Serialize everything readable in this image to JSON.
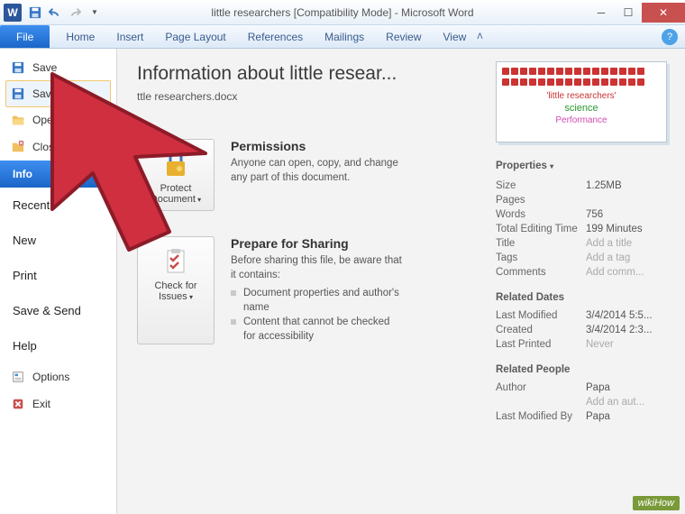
{
  "window": {
    "title": "little researchers [Compatibility Mode] - Microsoft Word"
  },
  "ribbon": {
    "file": "File",
    "tabs": [
      "Home",
      "Insert",
      "Page Layout",
      "References",
      "Mailings",
      "Review",
      "View"
    ]
  },
  "sidebar": {
    "save": "Save",
    "save_as": "Save As",
    "open": "Open",
    "close": "Close",
    "info": "Info",
    "recent": "Recent",
    "new": "New",
    "print": "Print",
    "save_send": "Save & Send",
    "help": "Help",
    "options": "Options",
    "exit": "Exit"
  },
  "info": {
    "heading": "Information about little resear...",
    "path": "ttle researchers.docx",
    "permissions": {
      "title": "Permissions",
      "desc": "Anyone can open, copy, and change any part of this document.",
      "btn": "Protect Document"
    },
    "prepare": {
      "title": "Prepare for Sharing",
      "desc": "Before sharing this file, be aware that it contains:",
      "btn": "Check for Issues",
      "bullets": [
        "Document properties and author's name",
        "Content that cannot be checked for accessibility"
      ]
    }
  },
  "thumb": {
    "line1": "'little researchers'",
    "line2": "science",
    "line3": "Performance"
  },
  "props": {
    "header": "Properties",
    "rows": [
      {
        "k": "Size",
        "v": "1.25MB"
      },
      {
        "k": "Pages",
        "v": ""
      },
      {
        "k": "Words",
        "v": "756"
      },
      {
        "k": "Total Editing Time",
        "v": "199 Minutes"
      },
      {
        "k": "Title",
        "v": "Add a title",
        "ph": true
      },
      {
        "k": "Tags",
        "v": "Add a tag",
        "ph": true
      },
      {
        "k": "Comments",
        "v": "Add comm...",
        "ph": true
      }
    ],
    "dates_h": "Related Dates",
    "dates": [
      {
        "k": "Last Modified",
        "v": "3/4/2014 5:5..."
      },
      {
        "k": "Created",
        "v": "3/4/2014 2:3..."
      },
      {
        "k": "Last Printed",
        "v": "Never",
        "ph": true
      }
    ],
    "people_h": "Related People",
    "people": [
      {
        "k": "Author",
        "v": "Papa"
      },
      {
        "k": "",
        "v": "Add an aut...",
        "ph": true
      },
      {
        "k": "Last Modified By",
        "v": "Papa"
      }
    ]
  },
  "watermark": "wikiHow"
}
